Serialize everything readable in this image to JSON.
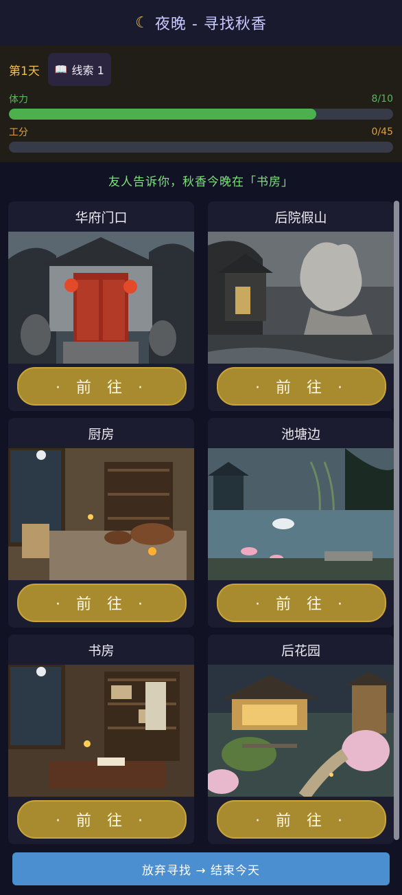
{
  "header": {
    "icon": "crescent-moon-icon",
    "title": "夜晚 - 寻找秋香"
  },
  "status": {
    "day": "第1天",
    "clue": {
      "icon": "book-icon",
      "label": "线索 1"
    },
    "stamina": {
      "label": "体力",
      "value_text": "8/10",
      "current": 8,
      "max": 10,
      "color": "#4db04f"
    },
    "work": {
      "label": "工分",
      "value_text": "0/45",
      "current": 0,
      "max": 45,
      "color": "#d08a32"
    }
  },
  "hint": "友人告诉你，秋香今晚在「书房」",
  "locations": [
    {
      "name": "华府门口",
      "button": "· 前 往 ·",
      "scene": "mansion-gate"
    },
    {
      "name": "后院假山",
      "button": "· 前 往 ·",
      "scene": "rockery"
    },
    {
      "name": "厨房",
      "button": "· 前 往 ·",
      "scene": "kitchen"
    },
    {
      "name": "池塘边",
      "button": "· 前 往 ·",
      "scene": "pond"
    },
    {
      "name": "书房",
      "button": "· 前 往 ·",
      "scene": "study"
    },
    {
      "name": "后花园",
      "button": "· 前 往 ·",
      "scene": "garden"
    }
  ],
  "footer": {
    "button": "放弃寻找 → 结束今天"
  },
  "colors": {
    "accent_gold": "#a98b2f",
    "footer_blue": "#4b8fd0",
    "hint_green": "#7fe07f"
  }
}
